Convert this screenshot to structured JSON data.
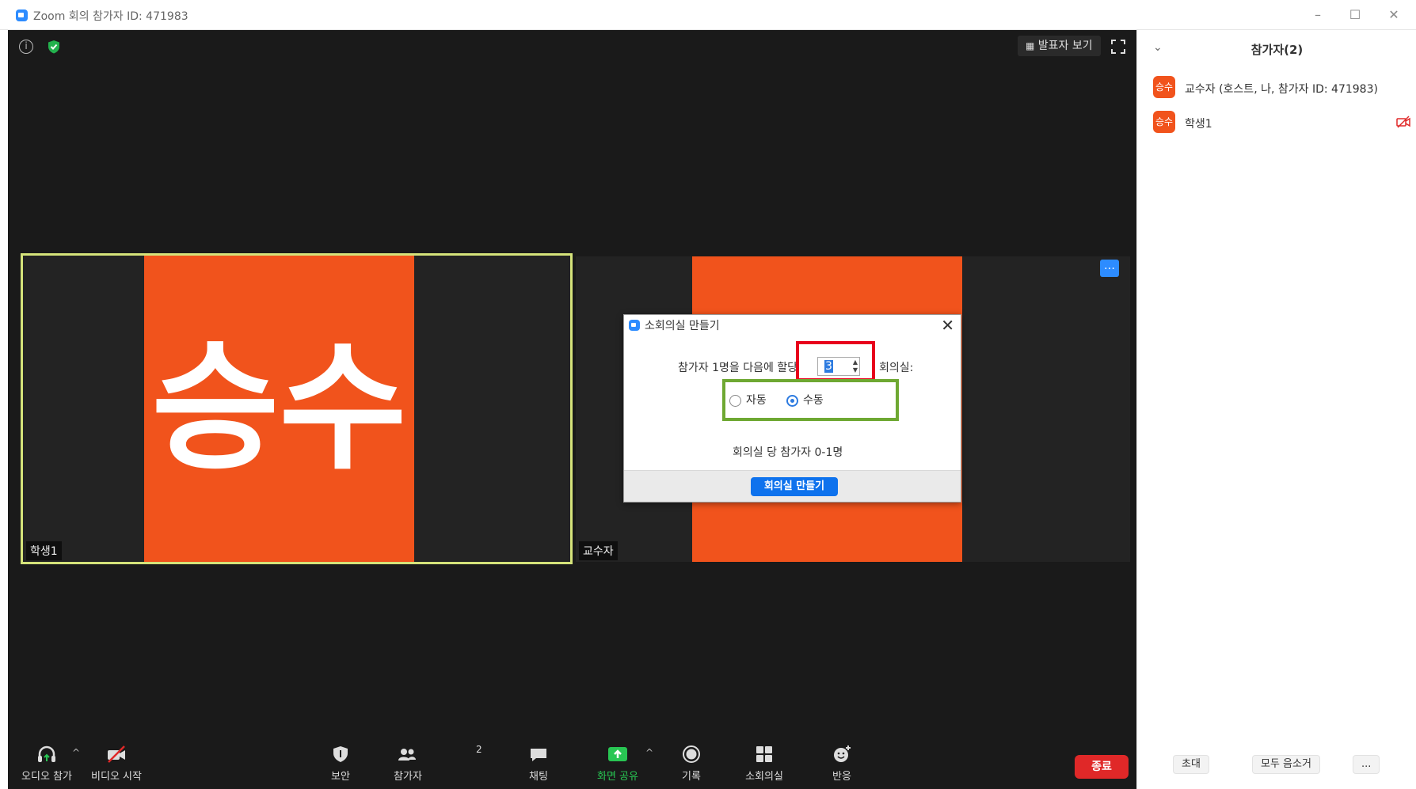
{
  "window": {
    "title": "Zoom 회의 참가자 ID: 471983",
    "minimize": "–",
    "maximize": "☐",
    "close": "✕"
  },
  "meeting": {
    "info_glyph": "i",
    "speaker_view_label": "발표자 보기",
    "more_glyph": "…"
  },
  "tiles": [
    {
      "avatar_text": "승수",
      "name": "학생1"
    },
    {
      "avatar_text": "승수",
      "name": "교수자"
    }
  ],
  "dialog": {
    "title": "소회의실 만들기",
    "close": "✕",
    "assign_label": "참가자 1명을 다음에 할당",
    "rooms_value": "3",
    "rooms_suffix": "회의실:",
    "option_auto": "자동",
    "option_manual": "수동",
    "selected": "수동",
    "per_room": "회의실 당 참가자 0-1명",
    "create_button": "회의실 만들기"
  },
  "toolbar": {
    "audio": "오디오 참가",
    "video": "비디오 시작",
    "security": "보안",
    "participants": "참가자",
    "participants_count": "2",
    "chat": "채팅",
    "share": "화면 공유",
    "record": "기록",
    "breakout": "소회의실",
    "reactions": "반응",
    "caret": "^",
    "end": "종료"
  },
  "panel": {
    "title": "참가자(2)",
    "collapse": "⌄",
    "participants": [
      {
        "avatar": "승수",
        "name": "교수자 (호스트, 나, 참가자 ID: 471983)"
      },
      {
        "avatar": "승수",
        "name": "학생1"
      }
    ],
    "invite": "초대",
    "mute_all": "모두 음소거",
    "more": "..."
  },
  "colors": {
    "avatar_orange": "#f1531c",
    "zoom_blue": "#2d8cff",
    "share_green": "#28c653",
    "end_red": "#e02828",
    "highlight_red": "#e8001c",
    "highlight_green": "#6ea832"
  },
  "icons": [
    "info-icon",
    "security-shield-icon",
    "grid-icon",
    "fullscreen-icon",
    "headphones-icon",
    "video-off-icon",
    "shield-icon",
    "people-icon",
    "chat-bubble-icon",
    "share-arrow-icon",
    "record-circle-icon",
    "breakout-grid-icon",
    "emoji-plus-icon",
    "camera-off-icon"
  ]
}
